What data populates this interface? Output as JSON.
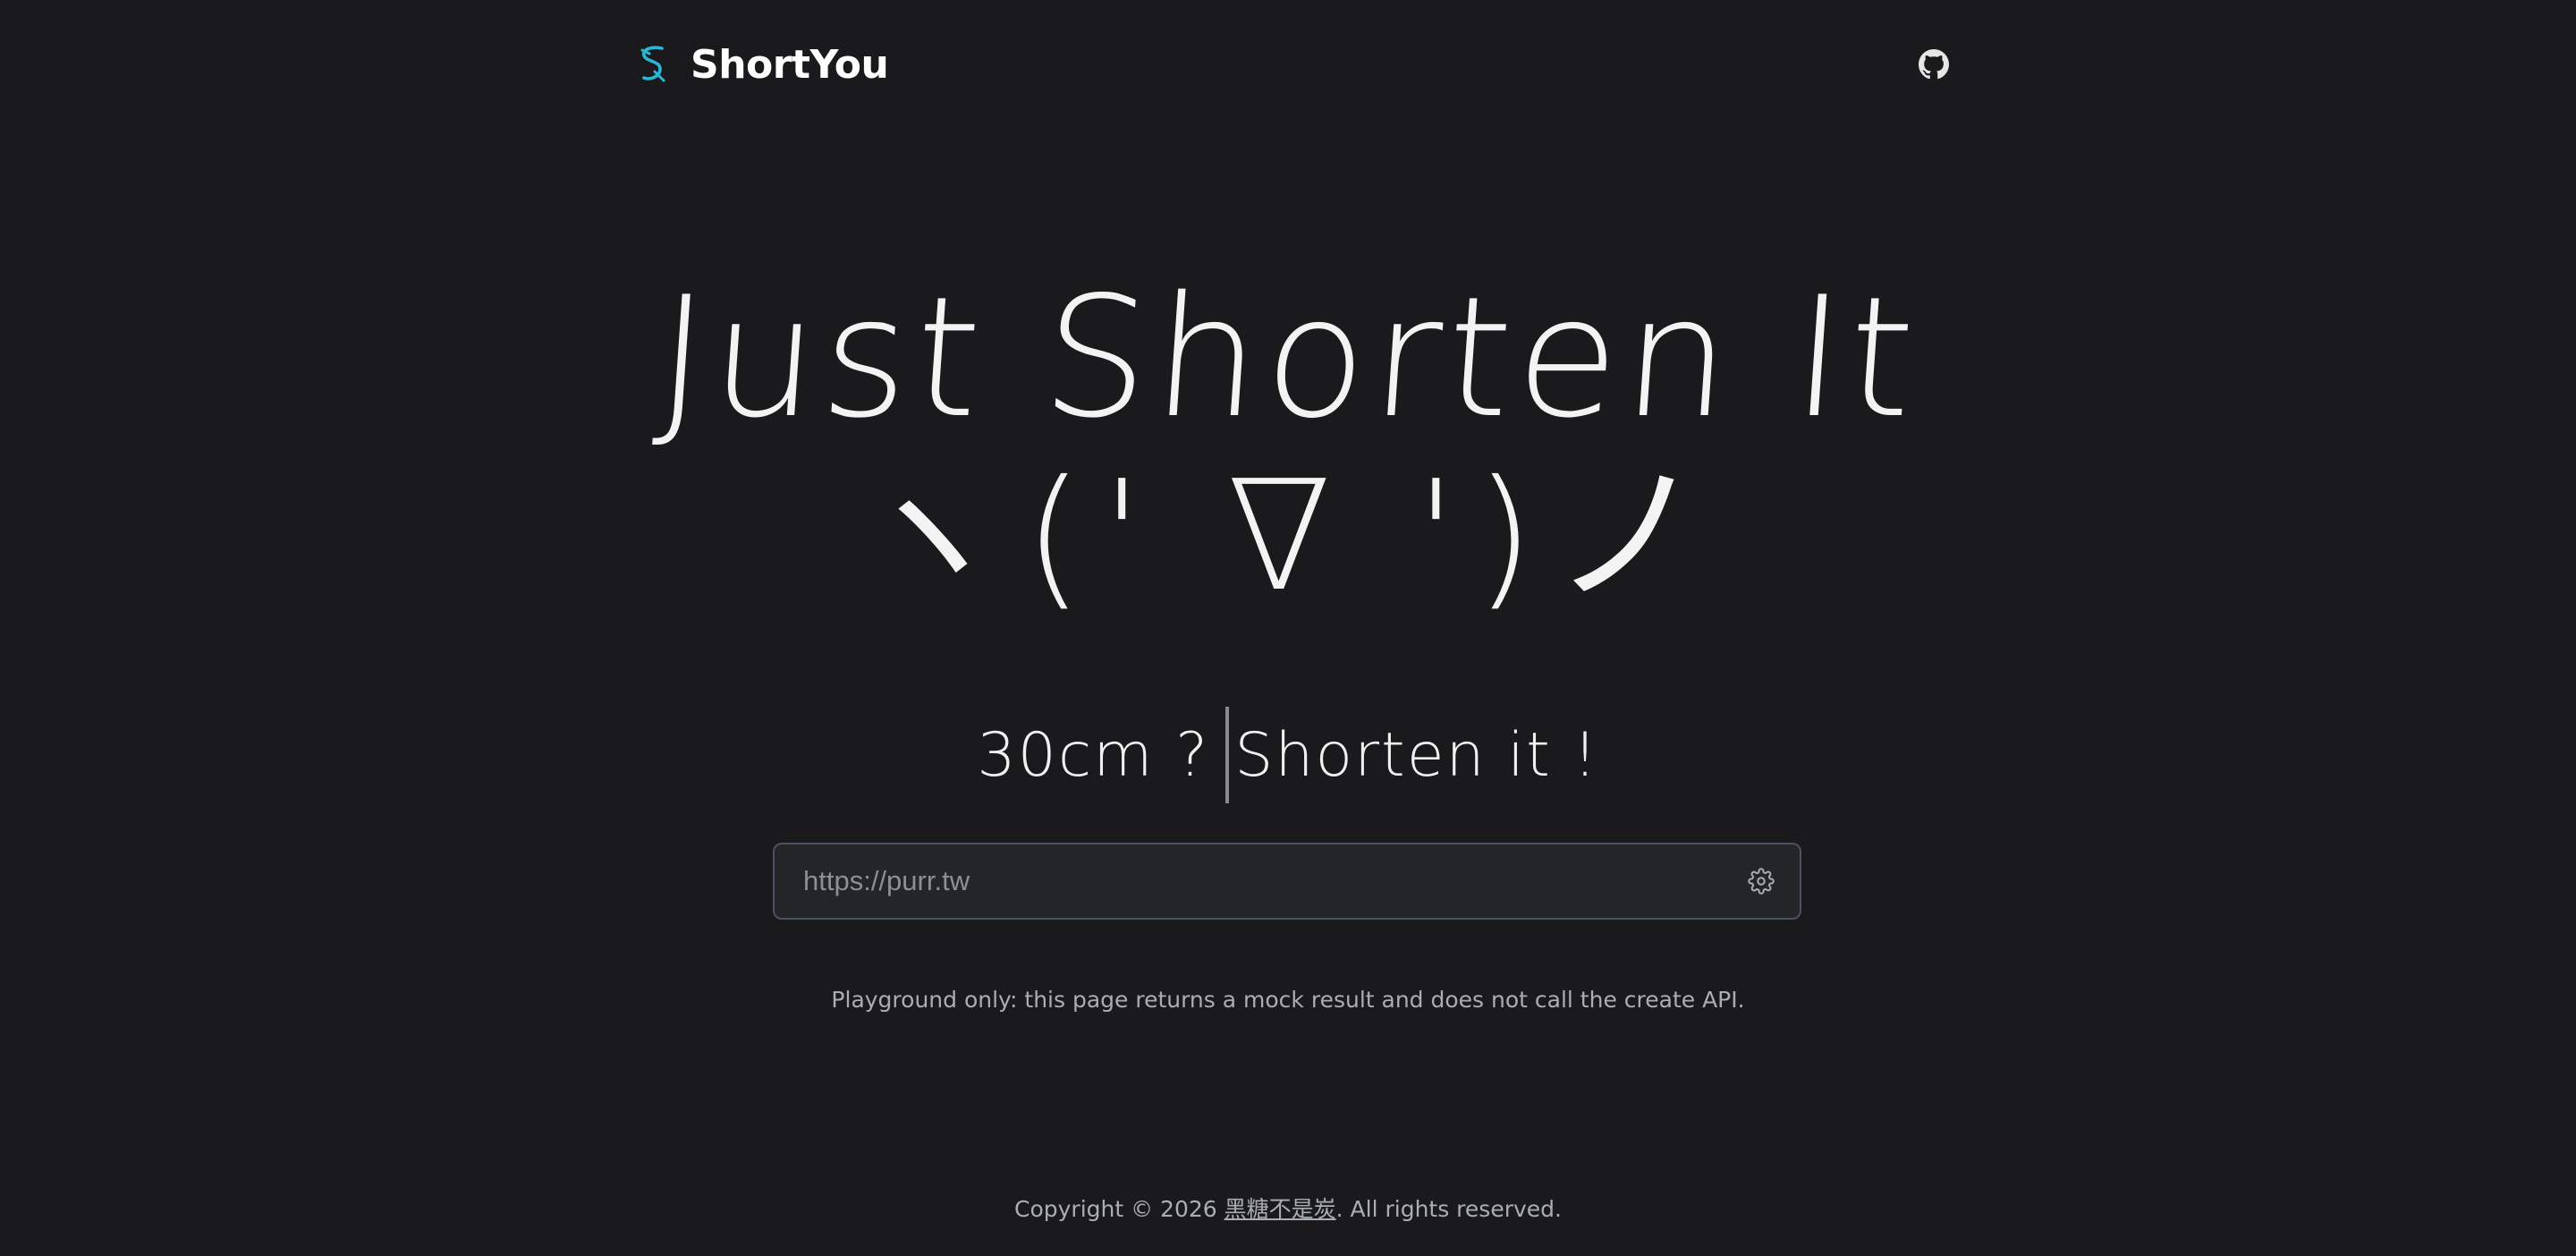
{
  "header": {
    "brand_name": "ShortYou",
    "logo_icon": "shortyou-logo-icon",
    "github_icon": "github-icon"
  },
  "hero": {
    "title": "Just Shorten It",
    "kaomoji": "ヽ(' ∇ ')ノ"
  },
  "tagline": {
    "prefix": "30cm ?",
    "suffix": "Shorten it !"
  },
  "url_input": {
    "placeholder": "https://purr.tw",
    "value": "",
    "settings_icon": "gear-icon"
  },
  "notice": "Playground only: this page returns a mock result and does not call the create API.",
  "footer": {
    "prefix": "Copyright © 2026 ",
    "author": "黑糖不是炭",
    "suffix": ". All rights reserved."
  },
  "colors": {
    "background": "#1a1a1c",
    "accent": "#2bb6d6",
    "text": "#f3f3f3",
    "muted": "#a9adb4",
    "input_border": "#4a5160"
  }
}
